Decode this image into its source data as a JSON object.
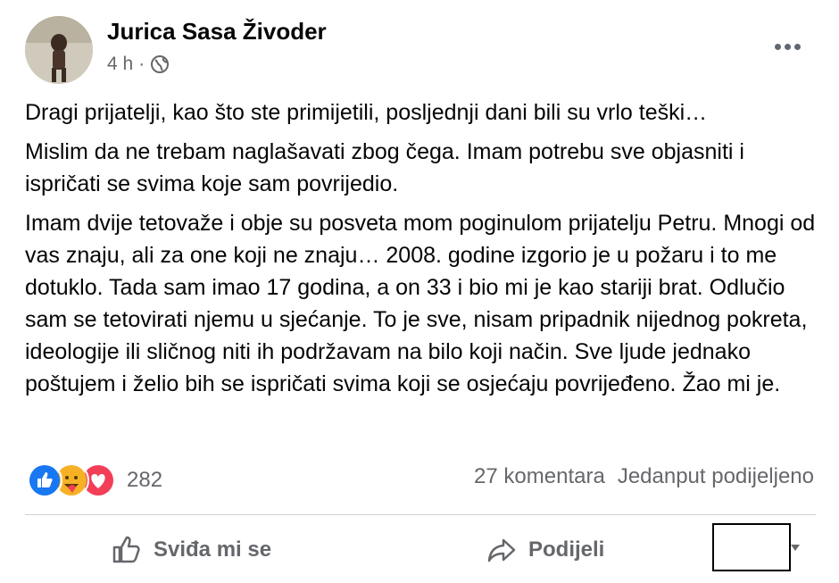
{
  "post": {
    "author": "Jurica Sasa Živoder",
    "time": "4 h",
    "separator": "·",
    "paragraphs": [
      "Dragi prijatelji, kao što ste primijetili, posljednji dani bili su vrlo teški…",
      "Mislim da ne trebam naglašavati zbog čega. Imam potrebu sve objasniti i ispričati se svima koje sam povrijedio.",
      "Imam dvije tetovaže i obje su posveta mom poginulom prijatelju Petru. Mnogi od vas znaju, ali za one koji ne znaju… 2008. godine izgorio je u požaru i to me dotuklo. Tada sam imao 17 godina, a on 33 i bio mi je kao stariji brat. Odlučio sam se tetovirati njemu u sjećanje. To je sve, nisam pripadnik nijednog pokreta, ideologije ili sličnog niti ih podržavam na bilo koji način. Sve ljude jednako poštujem i želio bih se ispričati svima koji se osjećaju povrijeđeno. Žao mi je."
    ]
  },
  "reactions": {
    "icons": [
      "like-icon",
      "care-icon",
      "love-icon"
    ],
    "count": "282",
    "comments": "27 komentara",
    "shares": "Jedanput podijeljeno"
  },
  "actions": {
    "like_label": "Sviđa mi se",
    "share_label": "Podijeli"
  },
  "colors": {
    "like": "#1877f2",
    "love": "#f33e58",
    "care": "#f7b125",
    "muted": "#65676b"
  }
}
